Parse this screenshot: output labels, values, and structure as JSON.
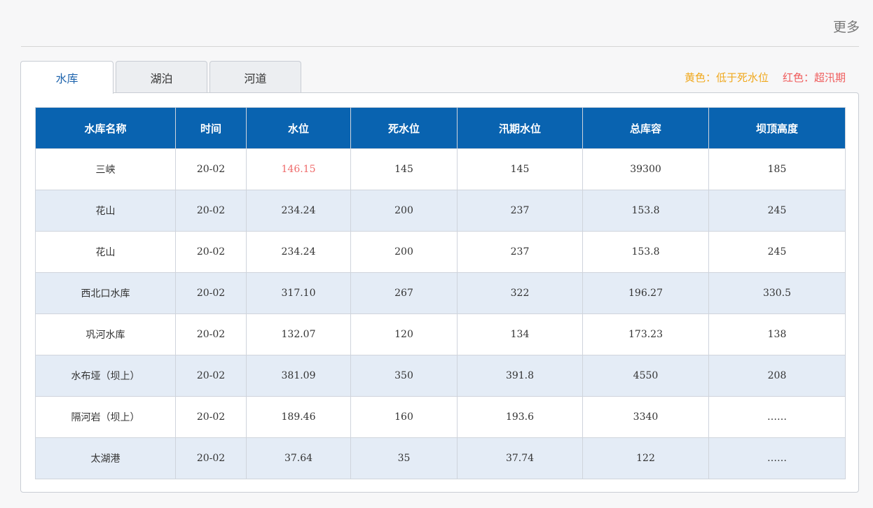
{
  "header": {
    "more_label": "更多"
  },
  "tabs": [
    {
      "label": "水库",
      "active": true
    },
    {
      "label": "湖泊",
      "active": false
    },
    {
      "label": "河道",
      "active": false
    }
  ],
  "legend": {
    "yellow": "黄色：低于死水位",
    "red": "红色：超汛期",
    "colors": {
      "yellow": "#f0a81d",
      "red": "#ef5b5b"
    }
  },
  "table": {
    "headers": [
      "水库名称",
      "时间",
      "水位",
      "死水位",
      "汛期水位",
      "总库容",
      "坝顶高度"
    ],
    "rows": [
      {
        "cells": [
          "三峡",
          "20-02",
          "146.15",
          "145",
          "145",
          "39300",
          "185"
        ],
        "level_status": "red"
      },
      {
        "cells": [
          "花山",
          "20-02",
          "234.24",
          "200",
          "237",
          "153.8",
          "245"
        ],
        "level_status": "normal"
      },
      {
        "cells": [
          "花山",
          "20-02",
          "234.24",
          "200",
          "237",
          "153.8",
          "245"
        ],
        "level_status": "normal"
      },
      {
        "cells": [
          "西北口水库",
          "20-02",
          "317.10",
          "267",
          "322",
          "196.27",
          "330.5"
        ],
        "level_status": "normal"
      },
      {
        "cells": [
          "巩河水库",
          "20-02",
          "132.07",
          "120",
          "134",
          "173.23",
          "138"
        ],
        "level_status": "normal"
      },
      {
        "cells": [
          "水布垭（坝上）",
          "20-02",
          "381.09",
          "350",
          "391.8",
          "4550",
          "208"
        ],
        "level_status": "normal"
      },
      {
        "cells": [
          "隔河岩（坝上）",
          "20-02",
          "189.46",
          "160",
          "193.6",
          "3340",
          "……"
        ],
        "level_status": "normal"
      },
      {
        "cells": [
          "太湖港",
          "20-02",
          "37.64",
          "35",
          "37.74",
          "122",
          "……"
        ],
        "level_status": "normal"
      }
    ]
  },
  "colors": {
    "header_bg": "#0963b0",
    "alt_row_bg": "#e4ecf6",
    "active_tab_text": "#1e64ad"
  }
}
